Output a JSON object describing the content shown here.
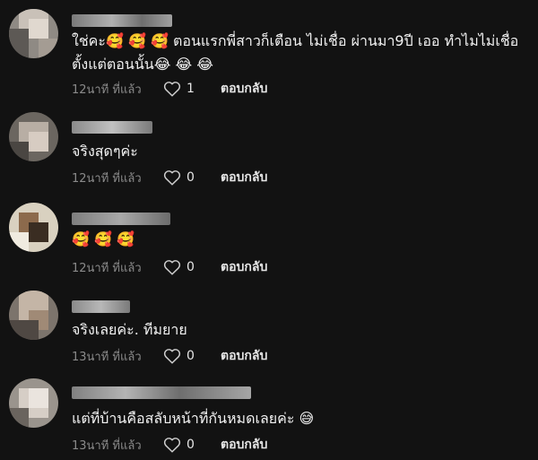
{
  "comments": [
    {
      "text": "ใช่คะ🥰 🥰 🥰  ตอนแรกพี่สาวก็เตือน ไม่เชื่อ ผ่านมา9ปี เออ ทำไมไม่เชื่อตั้งแต่ตอนนั้น😂 😂 😂",
      "time": "12นาที ที่แล้ว",
      "likes": "1",
      "reply": "ตอบกลับ"
    },
    {
      "text": "จริงสุดๆค่ะ",
      "time": "12นาที ที่แล้ว",
      "likes": "0",
      "reply": "ตอบกลับ"
    },
    {
      "text": "🥰 🥰 🥰",
      "time": "12นาที ที่แล้ว",
      "likes": "0",
      "reply": "ตอบกลับ"
    },
    {
      "text": "จริงเลยค่ะ. ทีมยาย",
      "time": "13นาที ที่แล้ว",
      "likes": "0",
      "reply": "ตอบกลับ"
    },
    {
      "text": "แต่ที่บ้านคือสลับหน้าที่กันหมดเลยค่ะ 😅",
      "time": "13นาที ที่แล้ว",
      "likes": "0",
      "reply": "ตอบกลับ"
    }
  ],
  "colors": {
    "background": "#121212",
    "text": "#f2f2f2",
    "meta": "#8a8a8a"
  },
  "icons": {
    "like": "heart-outline-icon",
    "avatar": "pixelated-avatar"
  }
}
